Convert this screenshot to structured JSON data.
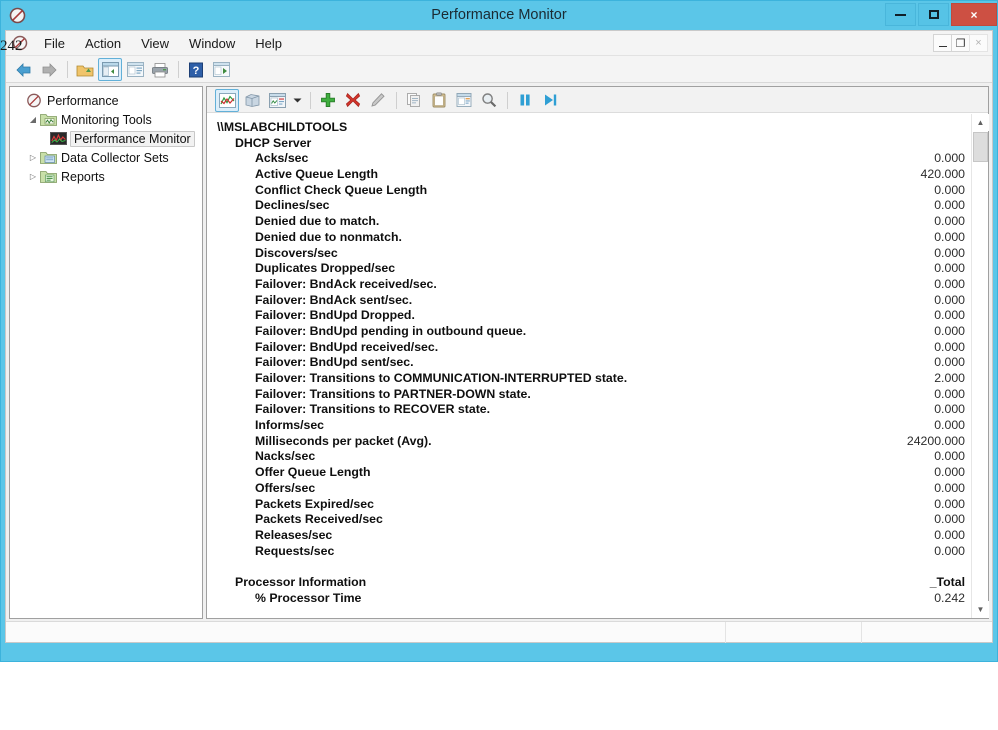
{
  "window": {
    "title": "Performance Monitor",
    "app_icon": "prohibited-icon",
    "accent_color": "#5bc6e8",
    "close_color": "#cd5043",
    "controls": {
      "minimize": "minimize-icon",
      "maximize": "maximize-icon",
      "close": "×"
    }
  },
  "mdi_controls": {
    "minimize": "minimize-icon",
    "restore": "❐",
    "close": "×"
  },
  "artifact": {
    "stray_text": "242"
  },
  "menubar": {
    "icon": "prohibited-icon",
    "items": [
      {
        "label": "File"
      },
      {
        "label": "Action"
      },
      {
        "label": "View"
      },
      {
        "label": "Window"
      },
      {
        "label": "Help"
      }
    ]
  },
  "navbar": {
    "buttons": [
      {
        "name": "back-icon",
        "type": "arrow-left",
        "color": "#3f93c9"
      },
      {
        "name": "forward-icon",
        "type": "arrow-right",
        "color": "#a6a6a6"
      },
      {
        "name": "up-folder-icon",
        "type": "folder-up"
      },
      {
        "name": "show-hide-console-tree-icon",
        "type": "window-pane",
        "selected": true
      },
      {
        "name": "properties-icon",
        "type": "window-props"
      },
      {
        "name": "print-icon",
        "type": "printer"
      },
      {
        "name": "help-icon",
        "type": "question"
      },
      {
        "name": "new-window-icon",
        "type": "window-play"
      }
    ]
  },
  "report_toolbar": {
    "buttons": [
      {
        "name": "view-line-graph-icon",
        "selected": true
      },
      {
        "name": "view-histogram-icon",
        "selected": false
      },
      {
        "name": "view-report-icon",
        "selected": false
      },
      {
        "name": "view-dropdown-icon",
        "selected": false
      },
      {
        "name": "add-counter-icon",
        "selected": false
      },
      {
        "name": "delete-counter-icon",
        "selected": false
      },
      {
        "name": "highlight-icon",
        "selected": false
      },
      {
        "name": "copy-properties-icon",
        "selected": false
      },
      {
        "name": "paste-counter-list-icon",
        "selected": false
      },
      {
        "name": "properties-icon",
        "selected": false
      },
      {
        "name": "zoom-icon",
        "selected": false
      },
      {
        "name": "freeze-display-icon",
        "selected": false
      },
      {
        "name": "update-data-icon",
        "selected": false
      }
    ]
  },
  "sidebar": {
    "items": [
      {
        "label": "Performance",
        "level": 0,
        "expander": "",
        "icon": "performance-icon",
        "selected": false
      },
      {
        "label": "Monitoring Tools",
        "level": 1,
        "expander": "◢",
        "icon": "folder-monitoring-icon",
        "selected": false
      },
      {
        "label": "Performance Monitor",
        "level": 2,
        "expander": "",
        "icon": "perfmon-chart-icon",
        "selected": true
      },
      {
        "label": "Data Collector Sets",
        "level": 1,
        "expander": "▷",
        "icon": "folder-collector-icon",
        "selected": false
      },
      {
        "label": "Reports",
        "level": 1,
        "expander": "▷",
        "icon": "folder-reports-icon",
        "selected": false
      }
    ]
  },
  "report": {
    "rows": [
      {
        "name": "\\\\MSLABCHILDTOOLS",
        "value": "",
        "level": 0,
        "value_is_header": false
      },
      {
        "name": "DHCP Server",
        "value": "",
        "level": 1,
        "value_is_header": false
      },
      {
        "name": "Acks/sec",
        "value": "0.000",
        "level": 2,
        "value_is_header": false
      },
      {
        "name": "Active Queue Length",
        "value": "420.000",
        "level": 2,
        "value_is_header": false
      },
      {
        "name": "Conflict Check Queue Length",
        "value": "0.000",
        "level": 2,
        "value_is_header": false
      },
      {
        "name": "Declines/sec",
        "value": "0.000",
        "level": 2,
        "value_is_header": false
      },
      {
        "name": "Denied due to match.",
        "value": "0.000",
        "level": 2,
        "value_is_header": false
      },
      {
        "name": "Denied due to nonmatch.",
        "value": "0.000",
        "level": 2,
        "value_is_header": false
      },
      {
        "name": "Discovers/sec",
        "value": "0.000",
        "level": 2,
        "value_is_header": false
      },
      {
        "name": "Duplicates Dropped/sec",
        "value": "0.000",
        "level": 2,
        "value_is_header": false
      },
      {
        "name": "Failover: BndAck received/sec.",
        "value": "0.000",
        "level": 2,
        "value_is_header": false
      },
      {
        "name": "Failover: BndAck sent/sec.",
        "value": "0.000",
        "level": 2,
        "value_is_header": false
      },
      {
        "name": "Failover: BndUpd Dropped.",
        "value": "0.000",
        "level": 2,
        "value_is_header": false
      },
      {
        "name": "Failover: BndUpd pending in outbound queue.",
        "value": "0.000",
        "level": 2,
        "value_is_header": false
      },
      {
        "name": "Failover: BndUpd received/sec.",
        "value": "0.000",
        "level": 2,
        "value_is_header": false
      },
      {
        "name": "Failover: BndUpd sent/sec.",
        "value": "0.000",
        "level": 2,
        "value_is_header": false
      },
      {
        "name": "Failover: Transitions to COMMUNICATION-INTERRUPTED state.",
        "value": "2.000",
        "level": 2,
        "value_is_header": false
      },
      {
        "name": "Failover: Transitions to PARTNER-DOWN state.",
        "value": "0.000",
        "level": 2,
        "value_is_header": false
      },
      {
        "name": "Failover: Transitions to RECOVER state.",
        "value": "0.000",
        "level": 2,
        "value_is_header": false
      },
      {
        "name": "Informs/sec",
        "value": "0.000",
        "level": 2,
        "value_is_header": false
      },
      {
        "name": "Milliseconds per packet (Avg).",
        "value": "24200.000",
        "level": 2,
        "value_is_header": false
      },
      {
        "name": "Nacks/sec",
        "value": "0.000",
        "level": 2,
        "value_is_header": false
      },
      {
        "name": "Offer Queue Length",
        "value": "0.000",
        "level": 2,
        "value_is_header": false
      },
      {
        "name": "Offers/sec",
        "value": "0.000",
        "level": 2,
        "value_is_header": false
      },
      {
        "name": "Packets Expired/sec",
        "value": "0.000",
        "level": 2,
        "value_is_header": false
      },
      {
        "name": "Packets Received/sec",
        "value": "0.000",
        "level": 2,
        "value_is_header": false
      },
      {
        "name": "Releases/sec",
        "value": "0.000",
        "level": 2,
        "value_is_header": false
      },
      {
        "name": "Requests/sec",
        "value": "0.000",
        "level": 2,
        "value_is_header": false
      },
      {
        "spacer": true
      },
      {
        "name": "Processor Information",
        "value": "_Total",
        "level": 1,
        "value_is_header": true
      },
      {
        "name": "% Processor Time",
        "value": "0.242",
        "level": 2,
        "value_is_header": false
      }
    ]
  },
  "statusbar": {
    "pane1": "",
    "pane2": "",
    "pane3": ""
  }
}
